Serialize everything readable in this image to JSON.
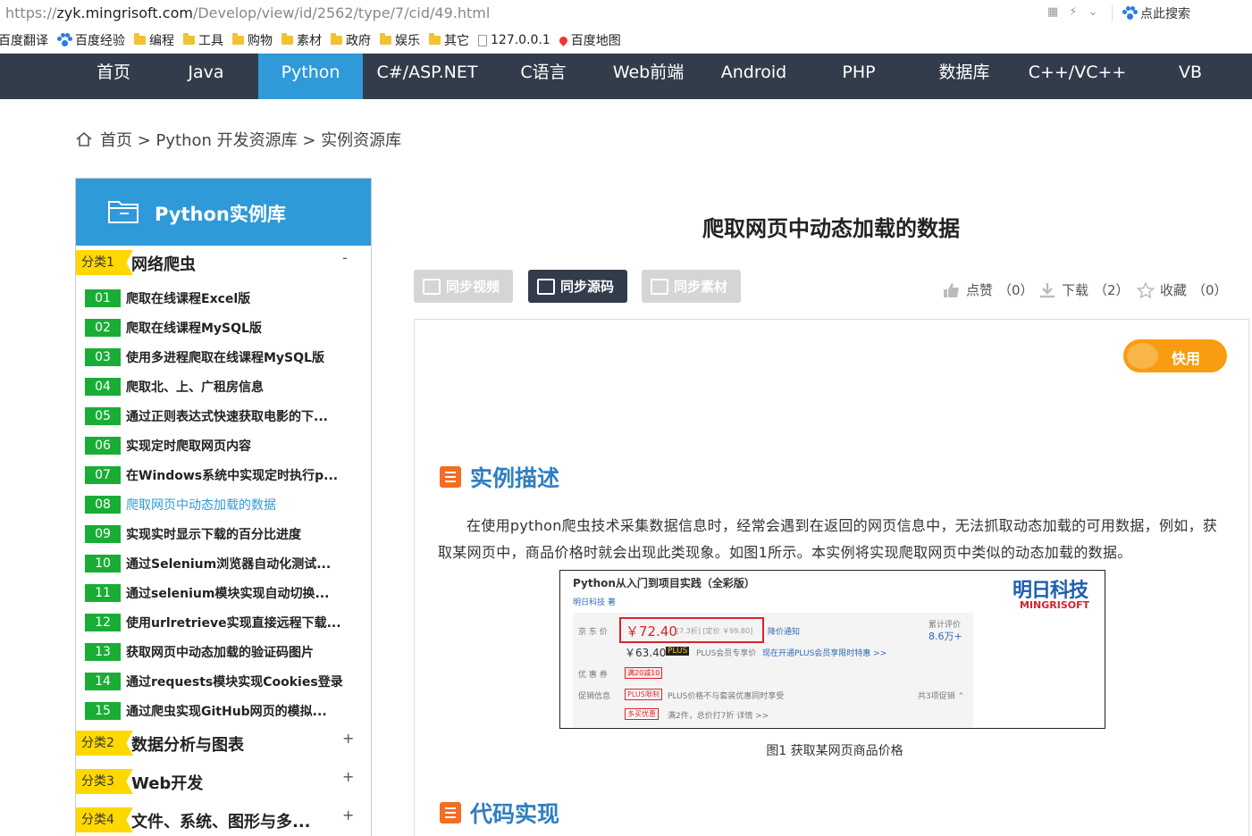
{
  "browser": {
    "url_prefix": "https://",
    "url_host": "zyk.mingrisoft.com",
    "url_path": "/Develop/view/id/2562/type/7/cid/49.html",
    "search_label": "点此搜索"
  },
  "bookmarks": [
    {
      "label": "百度翻译",
      "icon": "none"
    },
    {
      "label": "百度经验",
      "icon": "baidu-paw-icon"
    },
    {
      "label": "编程",
      "icon": "folder-icon"
    },
    {
      "label": "工具",
      "icon": "folder-icon"
    },
    {
      "label": "购物",
      "icon": "folder-icon"
    },
    {
      "label": "素材",
      "icon": "folder-icon"
    },
    {
      "label": "政府",
      "icon": "folder-icon"
    },
    {
      "label": "娱乐",
      "icon": "folder-icon"
    },
    {
      "label": "其它",
      "icon": "folder-icon"
    },
    {
      "label": "127.0.0.1",
      "icon": "page-icon"
    },
    {
      "label": "百度地图",
      "icon": "map-pin-icon"
    }
  ],
  "nav": [
    {
      "label": "首页"
    },
    {
      "label": "Java"
    },
    {
      "label": "Python"
    },
    {
      "label": "C#/ASP.NET"
    },
    {
      "label": "C语言"
    },
    {
      "label": "Web前端"
    },
    {
      "label": "Android"
    },
    {
      "label": "PHP"
    },
    {
      "label": "数据库"
    },
    {
      "label": "C++/VC++"
    },
    {
      "label": "VB"
    }
  ],
  "breadcrumb": "首页 > Python 开发资源库 > 实例资源库",
  "sidebar": {
    "title": "Python实例库",
    "categories": [
      {
        "tag": "分类1",
        "name": "网络爬虫",
        "toggle": "-"
      },
      {
        "tag": "分类2",
        "name": "数据分析与图表",
        "toggle": "+"
      },
      {
        "tag": "分类3",
        "name": "Web开发",
        "toggle": "+"
      },
      {
        "tag": "分类4",
        "name": "文件、系统、图形与多...",
        "toggle": "+"
      }
    ],
    "items": [
      {
        "num": "01",
        "label": "爬取在线课程Excel版"
      },
      {
        "num": "02",
        "label": "爬取在线课程MySQL版"
      },
      {
        "num": "03",
        "label": "使用多进程爬取在线课程MySQL版"
      },
      {
        "num": "04",
        "label": "爬取北、上、广租房信息"
      },
      {
        "num": "05",
        "label": "通过正则表达式快速获取电影的下..."
      },
      {
        "num": "06",
        "label": "实现定时爬取网页内容"
      },
      {
        "num": "07",
        "label": "在Windows系统中实现定时执行p..."
      },
      {
        "num": "08",
        "label": "爬取网页中动态加载的数据"
      },
      {
        "num": "09",
        "label": "实现实时显示下载的百分比进度"
      },
      {
        "num": "10",
        "label": "通过Selenium浏览器自动化测试..."
      },
      {
        "num": "11",
        "label": "通过selenium模块实现自动切换..."
      },
      {
        "num": "12",
        "label": "使用urlretrieve实现直接远程下载..."
      },
      {
        "num": "13",
        "label": "获取网页中动态加载的验证码图片"
      },
      {
        "num": "14",
        "label": "通过requests模块实现Cookies登录"
      },
      {
        "num": "15",
        "label": "通过爬虫实现GitHub网页的模拟..."
      }
    ]
  },
  "main": {
    "title": "爬取网页中动态加载的数据",
    "buttons": {
      "video": "同步视频",
      "source": "同步源码",
      "material": "同步素材"
    },
    "stats": {
      "like_label": "点赞",
      "like_count": "（0）",
      "download_label": "下载",
      "download_count": "（2）",
      "fav_label": "收藏",
      "fav_count": "（0）"
    },
    "quick_label": "快用",
    "section1": "实例描述",
    "paragraph": "在使用python爬虫技术采集数据信息时，经常会遇到在返回的网页信息中，无法抓取动态加载的可用数据，例如，获取某网页中，商品价格时就会出现此类现象。如图1所示。本实例将实现爬取网页中类似的动态加载的数据。",
    "figure": {
      "book_title": "Python从入门到项目实践（全彩版）",
      "author": "明日科技 著",
      "logo": "明日科技",
      "logo_en": "MINGRISOFT",
      "price_label": "京 东 价",
      "price": "￥72.40",
      "price_detail": "[7.3折] [定价 ￥99.80]",
      "price_notice": "降价通知",
      "review_label": "累计评价",
      "review_count": "8.6万+",
      "plus_price": "￥63.40",
      "plus_badge": "PLUS",
      "plus_text": "PLUS会员专享价",
      "plus_link": "现在开通PLUS会员享限时特惠 >>",
      "coupon_label": "优 惠 券",
      "coupon": "满20减10",
      "promo_label": "促销信息",
      "promo_tag1": "PLUS限制",
      "promo_text1": "PLUS价格不与套装优惠同时享受",
      "promo_tag2": "多买优惠",
      "promo_text2": "满2件，总价打7折   详情 >>",
      "promo_more": "共3项促销 ⌃"
    },
    "caption": "图1  获取某网页商品价格",
    "section2": "代码实现"
  },
  "colors": {
    "nav_bg": "#333c4b",
    "accent": "#2f9ad8",
    "green": "#1aad36",
    "tag_yellow": "#ffd800",
    "orange": "#f99c12"
  }
}
